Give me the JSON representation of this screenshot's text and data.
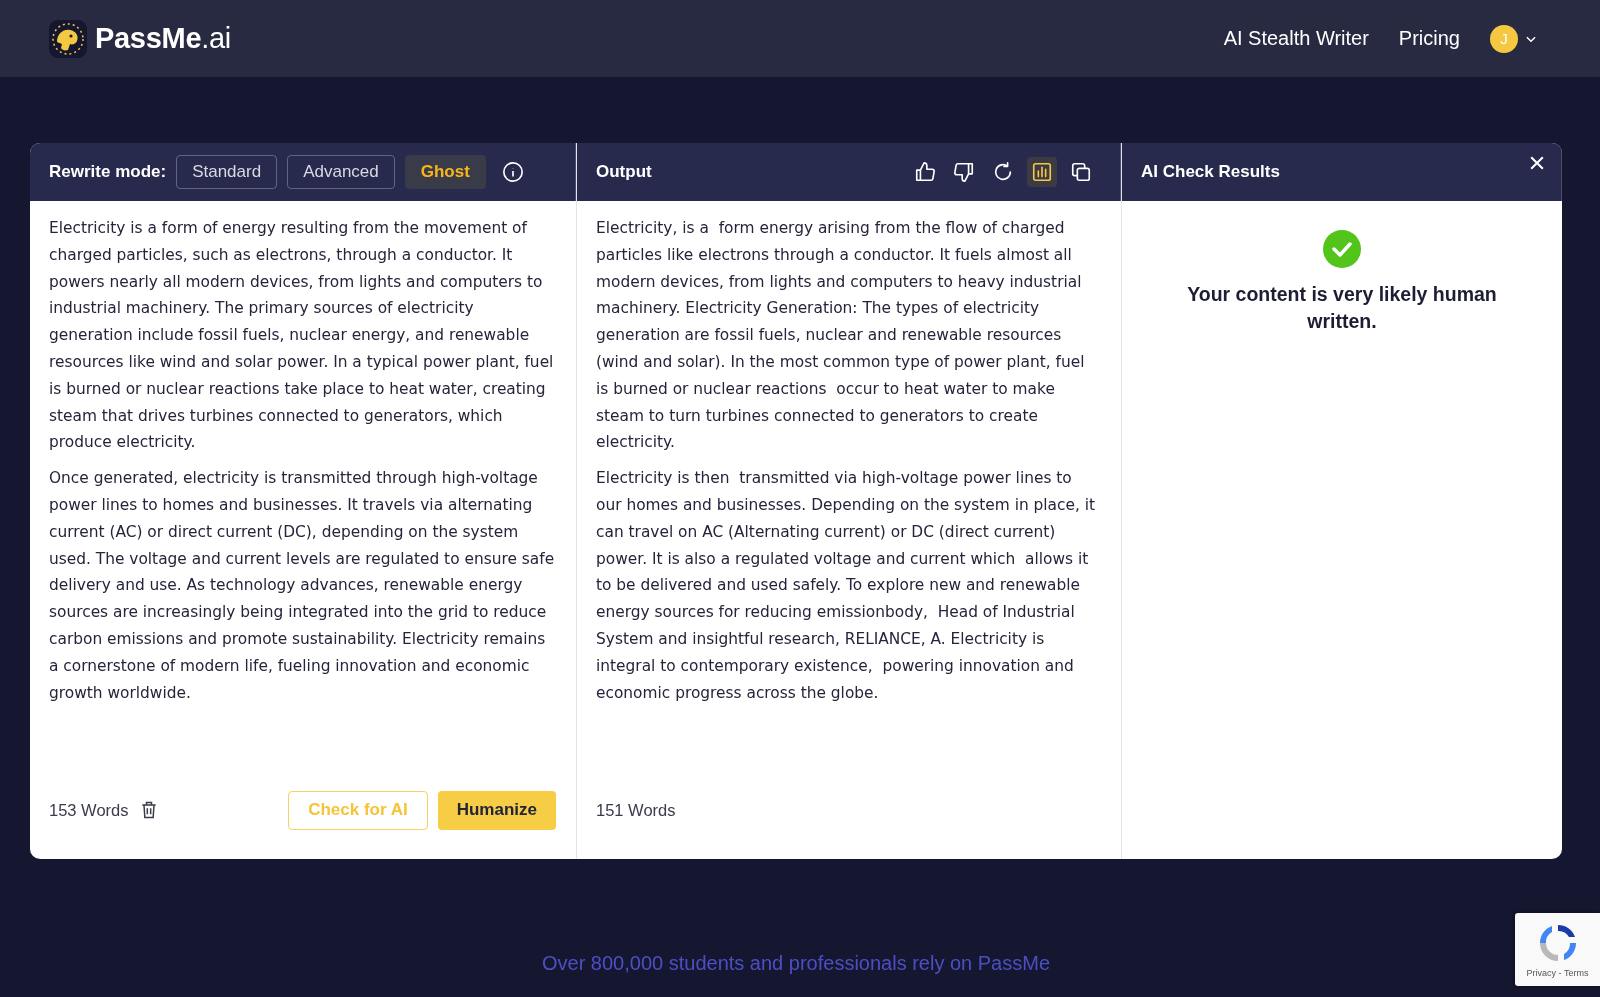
{
  "header": {
    "brand": {
      "name": "PassMe",
      "suffix": ".ai"
    },
    "nav": [
      "AI Stealth Writer",
      "Pricing"
    ],
    "avatar": "J"
  },
  "editor": {
    "mode_label": "Rewrite mode:",
    "modes": [
      {
        "label": "Standard",
        "selected": false
      },
      {
        "label": "Advanced",
        "selected": false
      },
      {
        "label": "Ghost",
        "selected": true
      }
    ],
    "paragraphs": [
      "Electricity is a form of energy resulting from the movement of charged particles, such as electrons, through a conductor. It powers nearly all modern devices, from lights and computers to industrial machinery. The primary sources of electricity generation include fossil fuels, nuclear energy, and renewable resources like wind and solar power. In a typical power plant, fuel is burned or nuclear reactions take place to heat water, creating steam that drives turbines connected to generators, which produce electricity.",
      "Once generated, electricity is transmitted through high-voltage power lines to homes and businesses. It travels via alternating current (AC) or direct current (DC), depending on the system used. The voltage and current levels are regulated to ensure safe delivery and use. As technology advances, renewable energy sources are increasingly being integrated into the grid to reduce carbon emissions and promote sustainability. Electricity remains a cornerstone of modern life, fueling innovation and economic growth worldwide."
    ],
    "word_count": "153 Words",
    "check_button": "Check for AI",
    "humanize_button": "Humanize"
  },
  "output": {
    "title": "Output",
    "tools": [
      {
        "kind": "thumbs-up",
        "selected": false
      },
      {
        "kind": "thumbs-down",
        "selected": false
      },
      {
        "kind": "refresh",
        "selected": false
      },
      {
        "kind": "chart",
        "selected": true
      },
      {
        "kind": "copy",
        "selected": false
      }
    ],
    "paragraphs": [
      "Electricity, is a  form energy arising from the flow of charged particles like electrons through a conductor. It fuels almost all modern devices, from lights and computers to heavy industrial  machinery. Electricity Generation: The types of electricity generation are fossil fuels, nuclear and renewable resources (wind and solar). In the most common type of power plant, fuel is burned or nuclear reactions  occur to heat water to make steam to turn turbines connected to generators to create electricity.",
      "Electricity is then  transmitted via high-voltage power lines to our homes and businesses. Depending on the system in place, it can travel on AC (Alternating current) or DC (direct current) power. It is also a regulated voltage and current which  allows it to be delivered and used safely. To explore new and renewable energy sources for reducing emissionbody,  Head of Industrial System and insightful research, RELIANCE, A. Electricity is integral to contemporary existence,  powering innovation and economic progress across the globe."
    ],
    "word_count": "151 Words"
  },
  "ai_check": {
    "title": "AI Check Results",
    "result": "Your content is very likely human written."
  },
  "tagline": "Over 800,000 students and professionals rely on PassMe",
  "recaptcha": {
    "links": "Privacy - Terms"
  }
}
